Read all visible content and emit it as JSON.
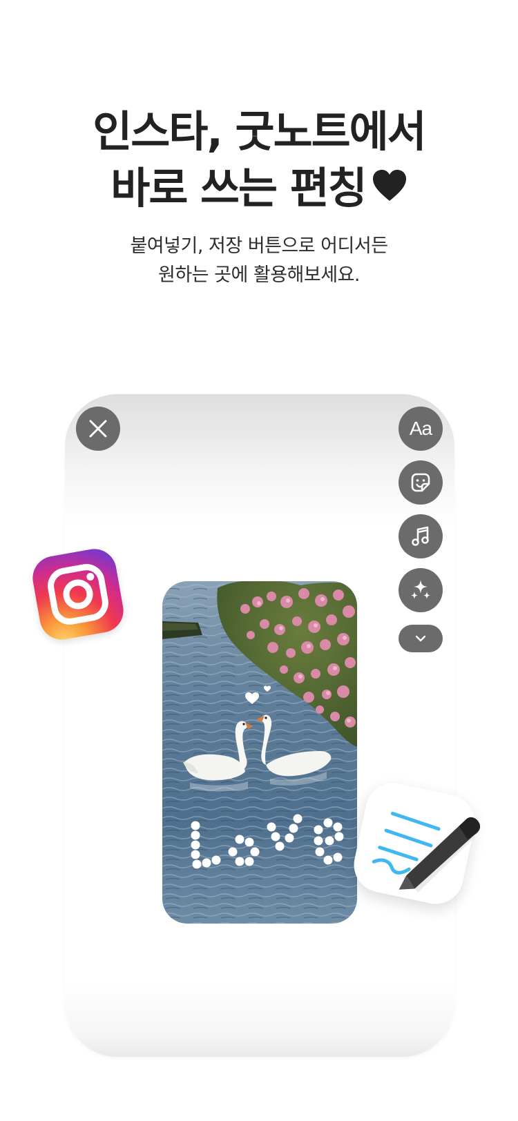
{
  "headline": {
    "line1": "인스타, 굿노트에서",
    "line2": "바로 쓰는 편칭"
  },
  "subline": {
    "line1": "붙여넣기, 저장 버튼으로 어디서든",
    "line2": "원하는 곳에 활용해보세요."
  },
  "story_editor": {
    "text_button_label": "Aa",
    "photo_text": "Love",
    "icons": {
      "close": "close-icon",
      "text": "text-icon",
      "sticker": "sticker-icon",
      "music": "music-icon",
      "effects": "sparkles-icon",
      "more": "chevron-down-icon"
    }
  },
  "apps": {
    "instagram": "instagram-logo",
    "goodnotes": "goodnotes-logo"
  },
  "colors": {
    "button_gray": "#6b6b6b",
    "heading_text": "#222222",
    "goodnotes_line": "#3fb7f0"
  }
}
